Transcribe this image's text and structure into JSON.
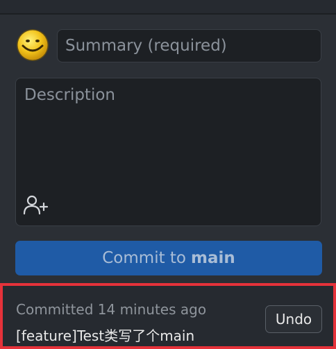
{
  "commit_form": {
    "summary": {
      "value": "",
      "placeholder": "Summary (required)"
    },
    "description": {
      "value": "",
      "placeholder": "Description"
    },
    "commit_button": {
      "prefix": "Commit to",
      "branch": "main"
    }
  },
  "last_commit": {
    "committed_text": "Committed 14 minutes ago",
    "message": "[feature]Test类写了个main",
    "undo_label": "Undo"
  },
  "colors": {
    "background": "#2b2f35",
    "input_bg": "#1d2024",
    "commit_button": "#1f5ba6",
    "highlight_border": "#e5323a"
  },
  "icons": {
    "avatar": "smiley-avatar-icon",
    "coauthor": "add-coauthor-icon"
  }
}
